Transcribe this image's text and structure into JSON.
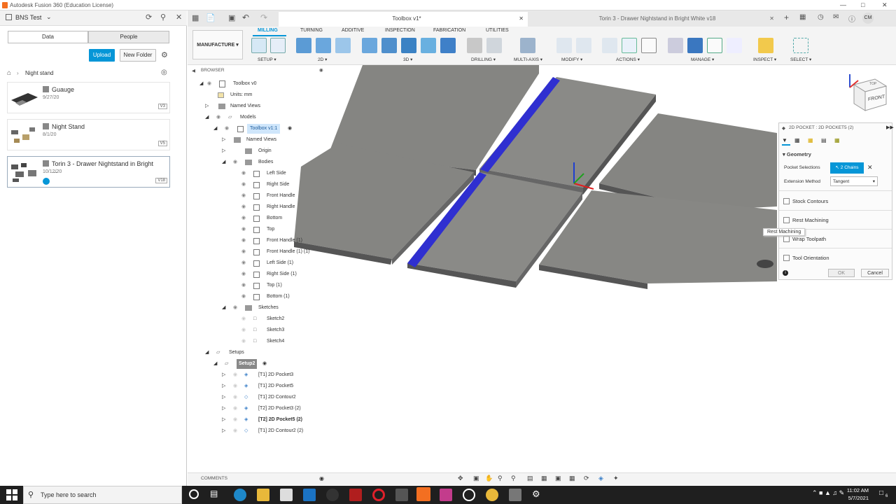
{
  "window": {
    "title": "Autodesk Fusion 360 (Education License)"
  },
  "leftpanel": {
    "team": "BNS Test",
    "tabs": [
      "Data",
      "People"
    ],
    "upload": "Upload",
    "new_folder": "New Folder",
    "breadcrumb": "Night stand",
    "cards": [
      {
        "name": "Guauge",
        "date": "9/27/20",
        "version": "V3"
      },
      {
        "name": "Night Stand",
        "date": "8/1/20",
        "version": "V5"
      },
      {
        "name": "Torin 3 - Drawer Nightstand in Bright ...",
        "date": "10/12/20",
        "version": "V18"
      }
    ]
  },
  "doc_tabs": [
    {
      "label": "Toolbox v1*"
    },
    {
      "label": "Torin 3 - Drawer Nightstand in Bright White v18"
    }
  ],
  "toolbar": {
    "workspace": "MANUFACTURE",
    "tabs": [
      "MILLING",
      "TURNING",
      "ADDITIVE",
      "INSPECTION",
      "FABRICATION",
      "UTILITIES"
    ],
    "groups": [
      "SETUP",
      "2D",
      "3D",
      "DRILLING",
      "MULTI-AXIS",
      "MODIFY",
      "ACTIONS",
      "MANAGE",
      "INSPECT",
      "SELECT"
    ]
  },
  "browser": {
    "title": "BROWSER",
    "rows": [
      {
        "label": "Toolbox v0"
      },
      {
        "label": "Units: mm"
      },
      {
        "label": "Named Views"
      },
      {
        "label": "Models"
      },
      {
        "label": "Toolbox v1:1"
      },
      {
        "label": "Named Views"
      },
      {
        "label": "Origin"
      },
      {
        "label": "Bodies"
      },
      {
        "label": "Left Side"
      },
      {
        "label": "Right Side"
      },
      {
        "label": "Front Handle"
      },
      {
        "label": "Right Handle"
      },
      {
        "label": "Bottom"
      },
      {
        "label": "Top"
      },
      {
        "label": "Front Handle (1)"
      },
      {
        "label": "Front Handle (1) (1)"
      },
      {
        "label": "Left Side (1)"
      },
      {
        "label": "Right Side (1)"
      },
      {
        "label": "Top (1)"
      },
      {
        "label": "Bottom (1)"
      },
      {
        "label": "Sketches"
      },
      {
        "label": "Sketch2"
      },
      {
        "label": "Sketch3"
      },
      {
        "label": "Sketch4"
      },
      {
        "label": "Setups"
      },
      {
        "label": "Setup2"
      },
      {
        "label": "[T1] 2D Pocket3"
      },
      {
        "label": "[T1] 2D Pocket5"
      },
      {
        "label": "[T1] 2D Contour2"
      },
      {
        "label": "[T2] 2D Pocket3 (2)"
      },
      {
        "label": "[T2] 2D Pocket5 (2)"
      },
      {
        "label": "[T1] 2D Contour2 (2)"
      }
    ]
  },
  "dialog": {
    "title": "2D POCKET : 2D POCKET5 (2)",
    "section": "Geometry",
    "pocket_sel_label": "Pocket Selections",
    "pocket_sel_value": "2 Chains",
    "ext_label": "Extension Method",
    "ext_value": "Tangent",
    "options": [
      "Stock Contours",
      "Rest Machining",
      "Wrap Toolpath",
      "Tool Orientation"
    ],
    "tooltip": "Rest Machining",
    "ok": "OK",
    "cancel": "Cancel"
  },
  "viewcube": {
    "front": "FRONT",
    "top": "TOP"
  },
  "comments": "COMMENTS",
  "taskbar": {
    "search_placeholder": "Type here to search",
    "time": "11:02 AM",
    "date": "5/7/2021",
    "notif": "6"
  },
  "colors": {
    "accent": "#0696d7",
    "body": "#8a8a88",
    "selected": "#2222cc"
  }
}
